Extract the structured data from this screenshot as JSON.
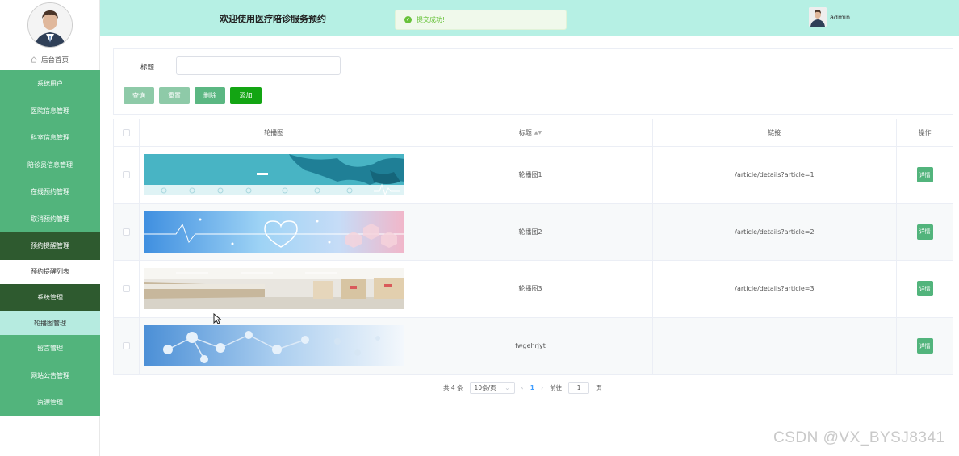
{
  "sidebar": {
    "home_label": "后台首页",
    "items": [
      {
        "label": "系统用户"
      },
      {
        "label": "医院信息管理"
      },
      {
        "label": "科室信息管理"
      },
      {
        "label": "陪诊员信息管理"
      },
      {
        "label": "在线预约管理"
      },
      {
        "label": "取消预约管理"
      },
      {
        "label": "预约提醒管理"
      },
      {
        "label": "预约提醒列表"
      },
      {
        "label": "系统管理"
      },
      {
        "label": "轮播图管理"
      },
      {
        "label": "留言管理"
      },
      {
        "label": "网站公告管理"
      },
      {
        "label": "资源管理"
      }
    ]
  },
  "header": {
    "title": "欢迎使用医疗陪诊服务预约",
    "toast": "提交成功!",
    "username": "admin"
  },
  "search": {
    "label": "标题",
    "value": "",
    "buttons": {
      "query": "查询",
      "reset": "重置",
      "delete": "删除",
      "add": "添加"
    }
  },
  "table": {
    "columns": {
      "image": "轮播图",
      "title": "标题",
      "link": "链接",
      "action": "操作"
    },
    "rows": [
      {
        "title": "轮播图1",
        "link": "/article/details?article=1",
        "action": "详情",
        "image": "world-map-banner"
      },
      {
        "title": "轮播图2",
        "link": "/article/details?article=2",
        "action": "详情",
        "image": "medical-heart-banner"
      },
      {
        "title": "轮播图3",
        "link": "/article/details?article=3",
        "action": "详情",
        "image": "hospital-hall-banner"
      },
      {
        "title": "fwgehrjyt",
        "link": "",
        "action": "详情",
        "image": "molecule-banner"
      }
    ]
  },
  "pagination": {
    "total": "共 4 条",
    "page_size": "10条/页",
    "current_page": "1",
    "goto_label": "前往",
    "goto_value": "1",
    "page_suffix": "页"
  },
  "watermark": "CSDN @VX_BYSJ8341",
  "colors": {
    "sidebar_green": "#52b47c",
    "sidebar_dark": "#2e5a2f",
    "header_bg": "#b6f0e4",
    "add_green": "#13a513",
    "success": "#67c23a"
  }
}
